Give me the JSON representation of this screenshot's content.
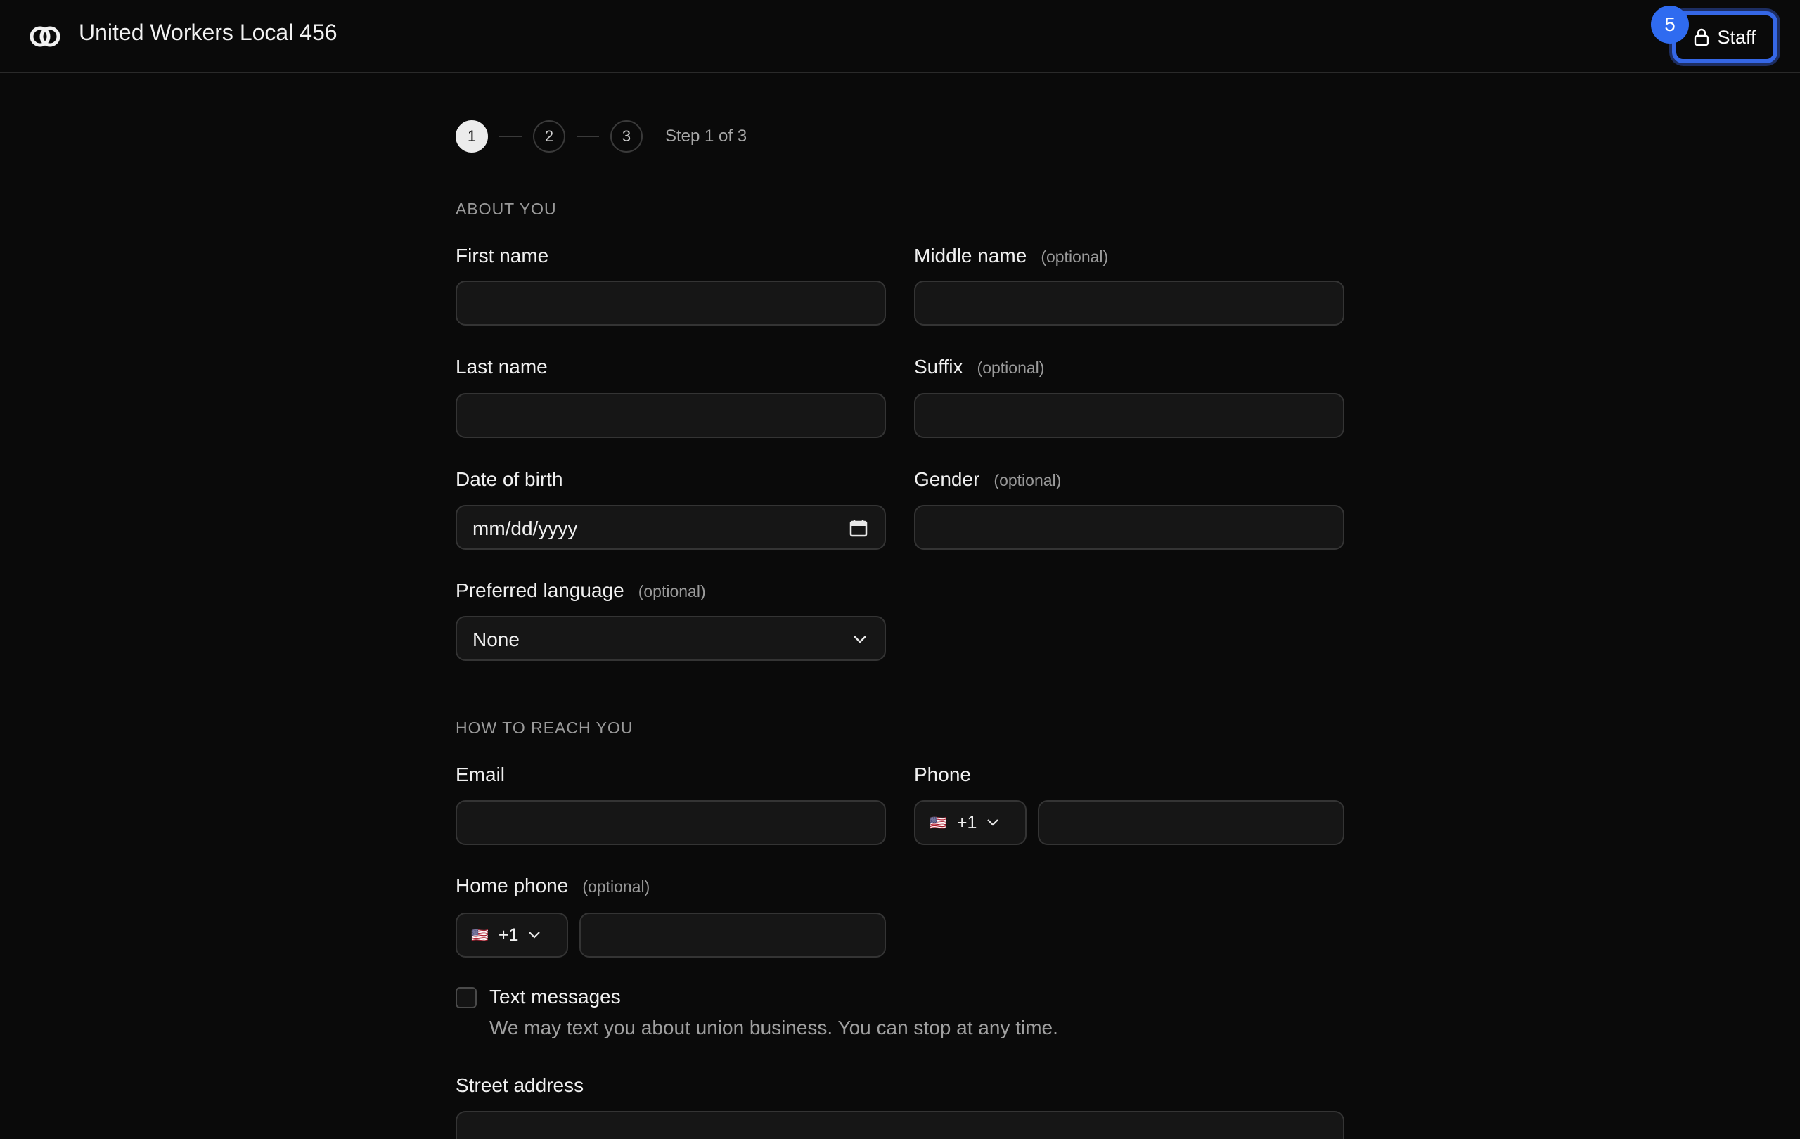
{
  "header": {
    "org_name": "United Workers Local 456",
    "staff_label": "Staff",
    "badge_count": "5"
  },
  "stepper": {
    "steps": [
      "1",
      "2",
      "3"
    ],
    "active_step": 1,
    "progress_text": "Step 1 of 3"
  },
  "sections": {
    "about": "ABOUT YOU",
    "reach": "HOW TO REACH YOU"
  },
  "optional_text": "(optional)",
  "fields": {
    "first_name": {
      "label": "First name",
      "value": ""
    },
    "middle_name": {
      "label": "Middle name",
      "value": ""
    },
    "last_name": {
      "label": "Last name",
      "value": ""
    },
    "suffix": {
      "label": "Suffix",
      "value": ""
    },
    "dob": {
      "label": "Date of birth",
      "placeholder": "mm/dd/yyyy"
    },
    "gender": {
      "label": "Gender",
      "value": ""
    },
    "language": {
      "label": "Preferred language",
      "selected": "None"
    },
    "email": {
      "label": "Email",
      "value": ""
    },
    "phone": {
      "label": "Phone",
      "country_code": "+1",
      "flag": "🇺🇸",
      "value": ""
    },
    "home_phone": {
      "label": "Home phone",
      "country_code": "+1",
      "flag": "🇺🇸",
      "value": ""
    },
    "text_messages": {
      "label": "Text messages",
      "help": "We may text you about union business. You can stop at any time.",
      "checked": false
    },
    "street": {
      "label": "Street address",
      "value": ""
    }
  },
  "icons": [
    "logo-icon",
    "lock-icon",
    "calendar-icon",
    "chevron-down-icon",
    "us-flag-icon"
  ],
  "colors": {
    "accent": "#3567e6",
    "badge": "#2f6bf0",
    "background": "#0a0a0a"
  }
}
